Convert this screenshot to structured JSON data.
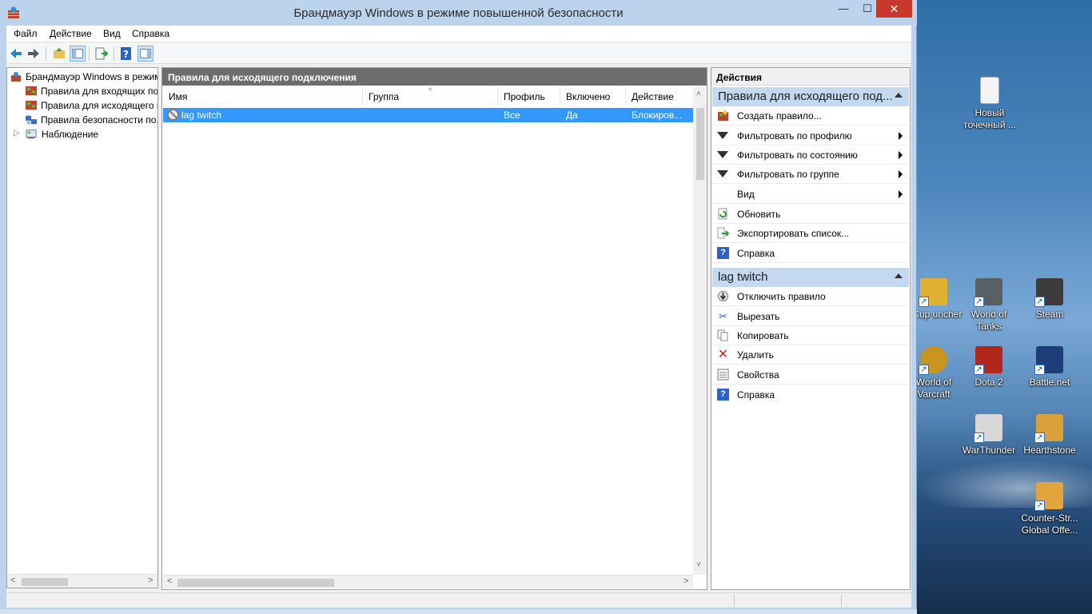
{
  "window": {
    "title": "Брандмауэр Windows в режиме повышенной безопасности",
    "minimize": "—",
    "maximize": "☐",
    "close": "✕"
  },
  "menu": [
    "Файл",
    "Действие",
    "Вид",
    "Справка"
  ],
  "toolbar": {
    "icons": [
      "back-icon",
      "forward-icon",
      "up-folder-icon",
      "show-hide-tree-icon",
      "export-icon",
      "help-icon",
      "show-hide-actions-icon"
    ]
  },
  "tree": {
    "root": "Брандмауэр Windows в режим",
    "items": [
      "Правила для входящих по,",
      "Правила для исходящего г",
      "Правила безопасности по,",
      "Наблюдение"
    ],
    "expander": "▷"
  },
  "center": {
    "header": "Правила для исходящего подключения",
    "columns": [
      "Имя",
      "Группа",
      "Профиль",
      "Включено",
      "Действие"
    ],
    "sort_indicator": "^",
    "rows": [
      {
        "name": "lag twitch",
        "group": "",
        "profile": "Все",
        "enabled": "Да",
        "action": "Блокиров..."
      }
    ]
  },
  "actions": {
    "title": "Действия",
    "sections": [
      {
        "title": "Правила для исходящего под...",
        "items": [
          {
            "label": "Создать правило...",
            "icon": "new-rule-icon",
            "submenu": false
          },
          {
            "label": "Фильтровать по профилю",
            "icon": "filter-icon",
            "submenu": true
          },
          {
            "label": "Фильтровать по состоянию",
            "icon": "filter-icon",
            "submenu": true
          },
          {
            "label": "Фильтровать по группе",
            "icon": "filter-icon",
            "submenu": true
          },
          {
            "label": "Вид",
            "icon": "",
            "submenu": true
          },
          {
            "label": "Обновить",
            "icon": "refresh-icon",
            "submenu": false
          },
          {
            "label": "Экспортировать список...",
            "icon": "export-icon",
            "submenu": false
          },
          {
            "label": "Справка",
            "icon": "help-icon",
            "submenu": false
          }
        ]
      },
      {
        "title": "lag twitch",
        "items": [
          {
            "label": "Отключить правило",
            "icon": "disable-icon",
            "submenu": false
          },
          {
            "label": "Вырезать",
            "icon": "cut-icon",
            "submenu": false
          },
          {
            "label": "Копировать",
            "icon": "copy-icon",
            "submenu": false
          },
          {
            "label": "Удалить",
            "icon": "delete-icon",
            "submenu": false
          },
          {
            "label": "Свойства",
            "icon": "properties-icon",
            "submenu": false
          },
          {
            "label": "Справка",
            "icon": "help-icon",
            "submenu": false
          }
        ]
      }
    ]
  },
  "desktop": {
    "icons": [
      {
        "label": "Новый точечный ...",
        "icon": "bitmap-file-icon"
      },
      {
        "label": "CCup uncher",
        "icon": "ccup-launcher-icon"
      },
      {
        "label": "World of Tanks",
        "icon": "world-of-tanks-icon"
      },
      {
        "label": "Steam",
        "icon": "steam-icon"
      },
      {
        "label": "World of Varcraft",
        "icon": "world-of-warcraft-icon"
      },
      {
        "label": "Dota 2",
        "icon": "dota2-icon"
      },
      {
        "label": "Battle.net",
        "icon": "battlenet-icon"
      },
      {
        "label": "WarThunder",
        "icon": "war-thunder-icon"
      },
      {
        "label": "Hearthstone",
        "icon": "hearthstone-icon"
      },
      {
        "label": "Counter-Str... Global Offe...",
        "icon": "csgo-icon"
      }
    ]
  },
  "colors": {
    "selection": "#3399ff",
    "pane_header": "#6d6d6d",
    "section_header": "#c4d9ef",
    "close_button": "#c7392b",
    "titlebar": "#bcd3ee"
  }
}
